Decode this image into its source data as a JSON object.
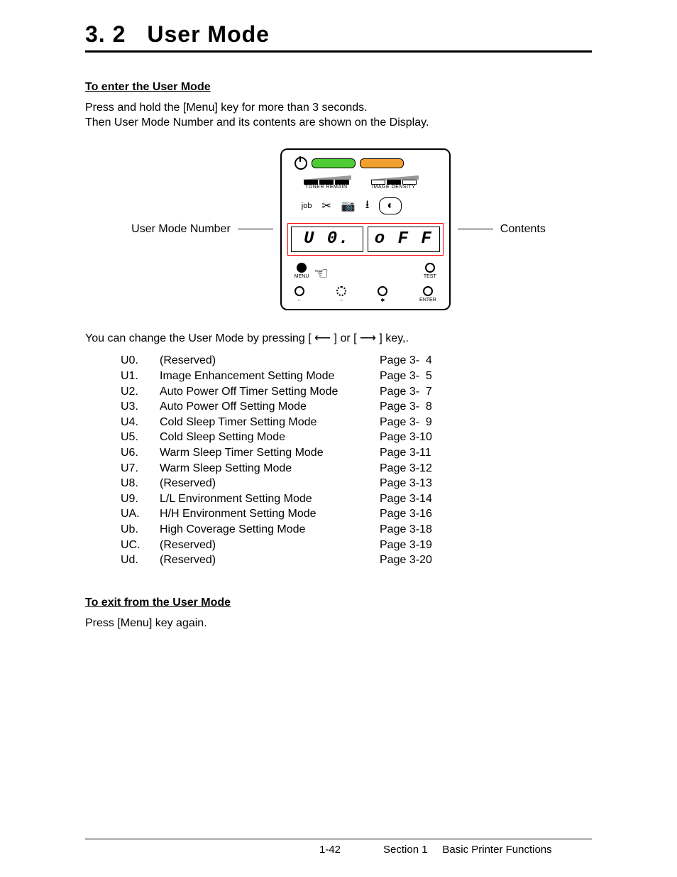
{
  "heading": {
    "number": "3. 2",
    "title": "User Mode"
  },
  "enter": {
    "title": "To enter the User Mode",
    "line1": "Press and hold the [Menu] key for more than 3 seconds.",
    "line2": "Then User Mode Number and its contents are shown on the Display."
  },
  "diagram": {
    "left_label": "User Mode Number",
    "right_label": "Contents",
    "toner_label": "TONER REMAIN",
    "density_label": "IMAGE DENSITY",
    "job_label": "job",
    "lcd_left": "U 0.",
    "lcd_right": "o F F",
    "btn_menu": "MENU",
    "btn_test": "TEST",
    "btn_left": "←",
    "btn_right": "→",
    "btn_star": "✱",
    "btn_enter": "ENTER"
  },
  "change": {
    "prefix": "You can change the User Mode by pressing  [  ",
    "mid": "  ] or [  ",
    "suffix": "  ] key,."
  },
  "modes": [
    {
      "code": "U0.",
      "desc": "(Reserved)",
      "page": "Page 3-  4"
    },
    {
      "code": "U1.",
      "desc": "Image Enhancement Setting Mode",
      "page": "Page 3-  5"
    },
    {
      "code": "U2.",
      "desc": "Auto Power Off Timer Setting Mode",
      "page": "Page 3-  7"
    },
    {
      "code": "U3.",
      "desc": "Auto Power Off Setting Mode",
      "page": "Page 3-  8"
    },
    {
      "code": "U4.",
      "desc": "Cold Sleep Timer Setting Mode",
      "page": "Page 3-  9"
    },
    {
      "code": "U5.",
      "desc": "Cold Sleep Setting Mode",
      "page": "Page 3-10"
    },
    {
      "code": "U6.",
      "desc": "Warm Sleep Timer Setting Mode",
      "page": "Page 3-11"
    },
    {
      "code": "U7.",
      "desc": "Warm Sleep Setting Mode",
      "page": "Page 3-12"
    },
    {
      "code": "U8.",
      "desc": "(Reserved)",
      "page": "Page 3-13"
    },
    {
      "code": "U9.",
      "desc": "L/L Environment Setting Mode",
      "page": "Page 3-14"
    },
    {
      "code": "UA.",
      "desc": "H/H Environment Setting Mode",
      "page": "Page 3-16"
    },
    {
      "code": "Ub.",
      "desc": "High Coverage Setting Mode",
      "page": "Page 3-18"
    },
    {
      "code": "UC.",
      "desc": "(Reserved)",
      "page": "Page 3-19"
    },
    {
      "code": "Ud.",
      "desc": "(Reserved)",
      "page": "Page 3-20"
    }
  ],
  "exit": {
    "title": "To exit from the User Mode",
    "text": "Press [Menu] key again."
  },
  "footer": {
    "page": "1-42",
    "section": "Section 1     Basic Printer Functions"
  }
}
